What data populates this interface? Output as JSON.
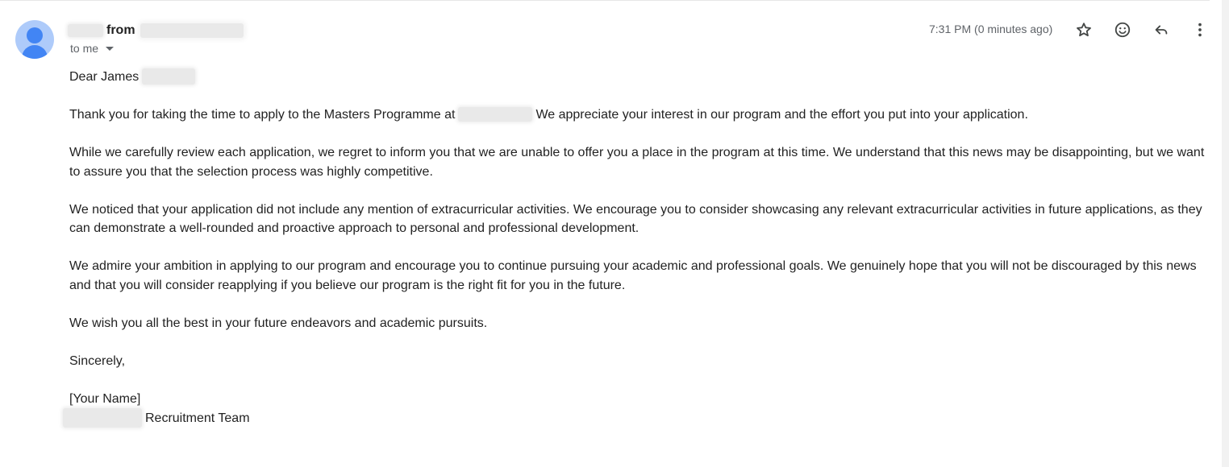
{
  "sender": {
    "from_label": "from"
  },
  "recipient": {
    "label": "to me"
  },
  "timestamp": "7:31 PM (0 minutes ago)",
  "actions": {
    "star": "star-icon",
    "emoji": "emoji-icon",
    "reply": "reply-icon",
    "more": "more-vert-icon"
  },
  "colors": {
    "avatar_bg": "#aecbfa",
    "avatar_fg": "#4285f4",
    "secondary_text": "#5f6368",
    "body_text": "#222222"
  },
  "body": {
    "greeting": "Dear James",
    "p1_start": "Thank you for taking the time to apply to the Masters Programme at",
    "p1_end": "We appreciate your interest in our program and the effort you put into your application.",
    "p2": "While we carefully review each application, we regret to inform you that we are unable to offer you a place in the program at this time. We understand that this news may be disappointing, but we want to assure you that the selection process was highly competitive.",
    "p3": "We noticed that your application did not include any mention of extracurricular activities. We encourage you to consider showcasing any relevant extracurricular activities in future applications, as they can demonstrate a well-rounded and proactive approach to personal and professional development.",
    "p4": "We admire your ambition in applying to our program and encourage you to continue pursuing your academic and professional goals. We genuinely hope that you will not be discouraged by this news and that you will consider reapplying if you believe our program is the right fit for you in the future.",
    "p5": "We wish you all the best in your future endeavors and academic pursuits.",
    "closing": "Sincerely,",
    "signature_name": "[Your Name]",
    "signature_team": "Recruitment Team"
  }
}
